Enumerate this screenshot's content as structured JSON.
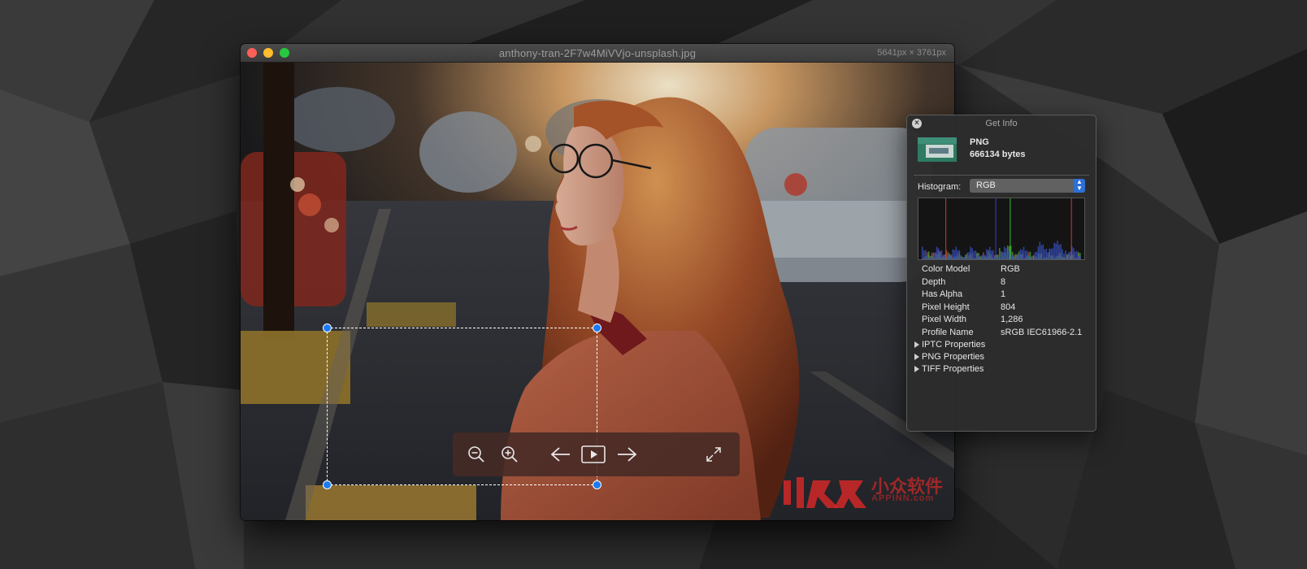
{
  "window": {
    "title": "anthony-tran-2F7w4MiVVjo-unsplash.jpg",
    "dimensions": "5641px × 3761px"
  },
  "toolbar": {
    "buttons": [
      "zoom-out-icon",
      "zoom-in-icon",
      "arrow-left-icon",
      "play-icon",
      "arrow-right-icon",
      "fullscreen-icon"
    ]
  },
  "watermark": {
    "cn": "小众软件",
    "en": "APPINN.com"
  },
  "info_panel": {
    "title": "Get Info",
    "format": "PNG",
    "size": "666134 bytes",
    "histogram_label": "Histogram:",
    "histogram_mode": "RGB",
    "properties": [
      {
        "key": "Color Model",
        "value": "RGB"
      },
      {
        "key": "Depth",
        "value": "8"
      },
      {
        "key": "Has Alpha",
        "value": "1"
      },
      {
        "key": "Pixel Height",
        "value": "804"
      },
      {
        "key": "Pixel Width",
        "value": "1,286"
      },
      {
        "key": "Profile Name",
        "value": "sRGB IEC61966-2.1"
      }
    ],
    "groups": [
      "IPTC Properties",
      "PNG Properties",
      "TIFF Properties"
    ]
  },
  "colors": {
    "accent": "#1c7bf2",
    "close": "#fe5f57",
    "minimize": "#febc2e",
    "zoom": "#28c840"
  }
}
